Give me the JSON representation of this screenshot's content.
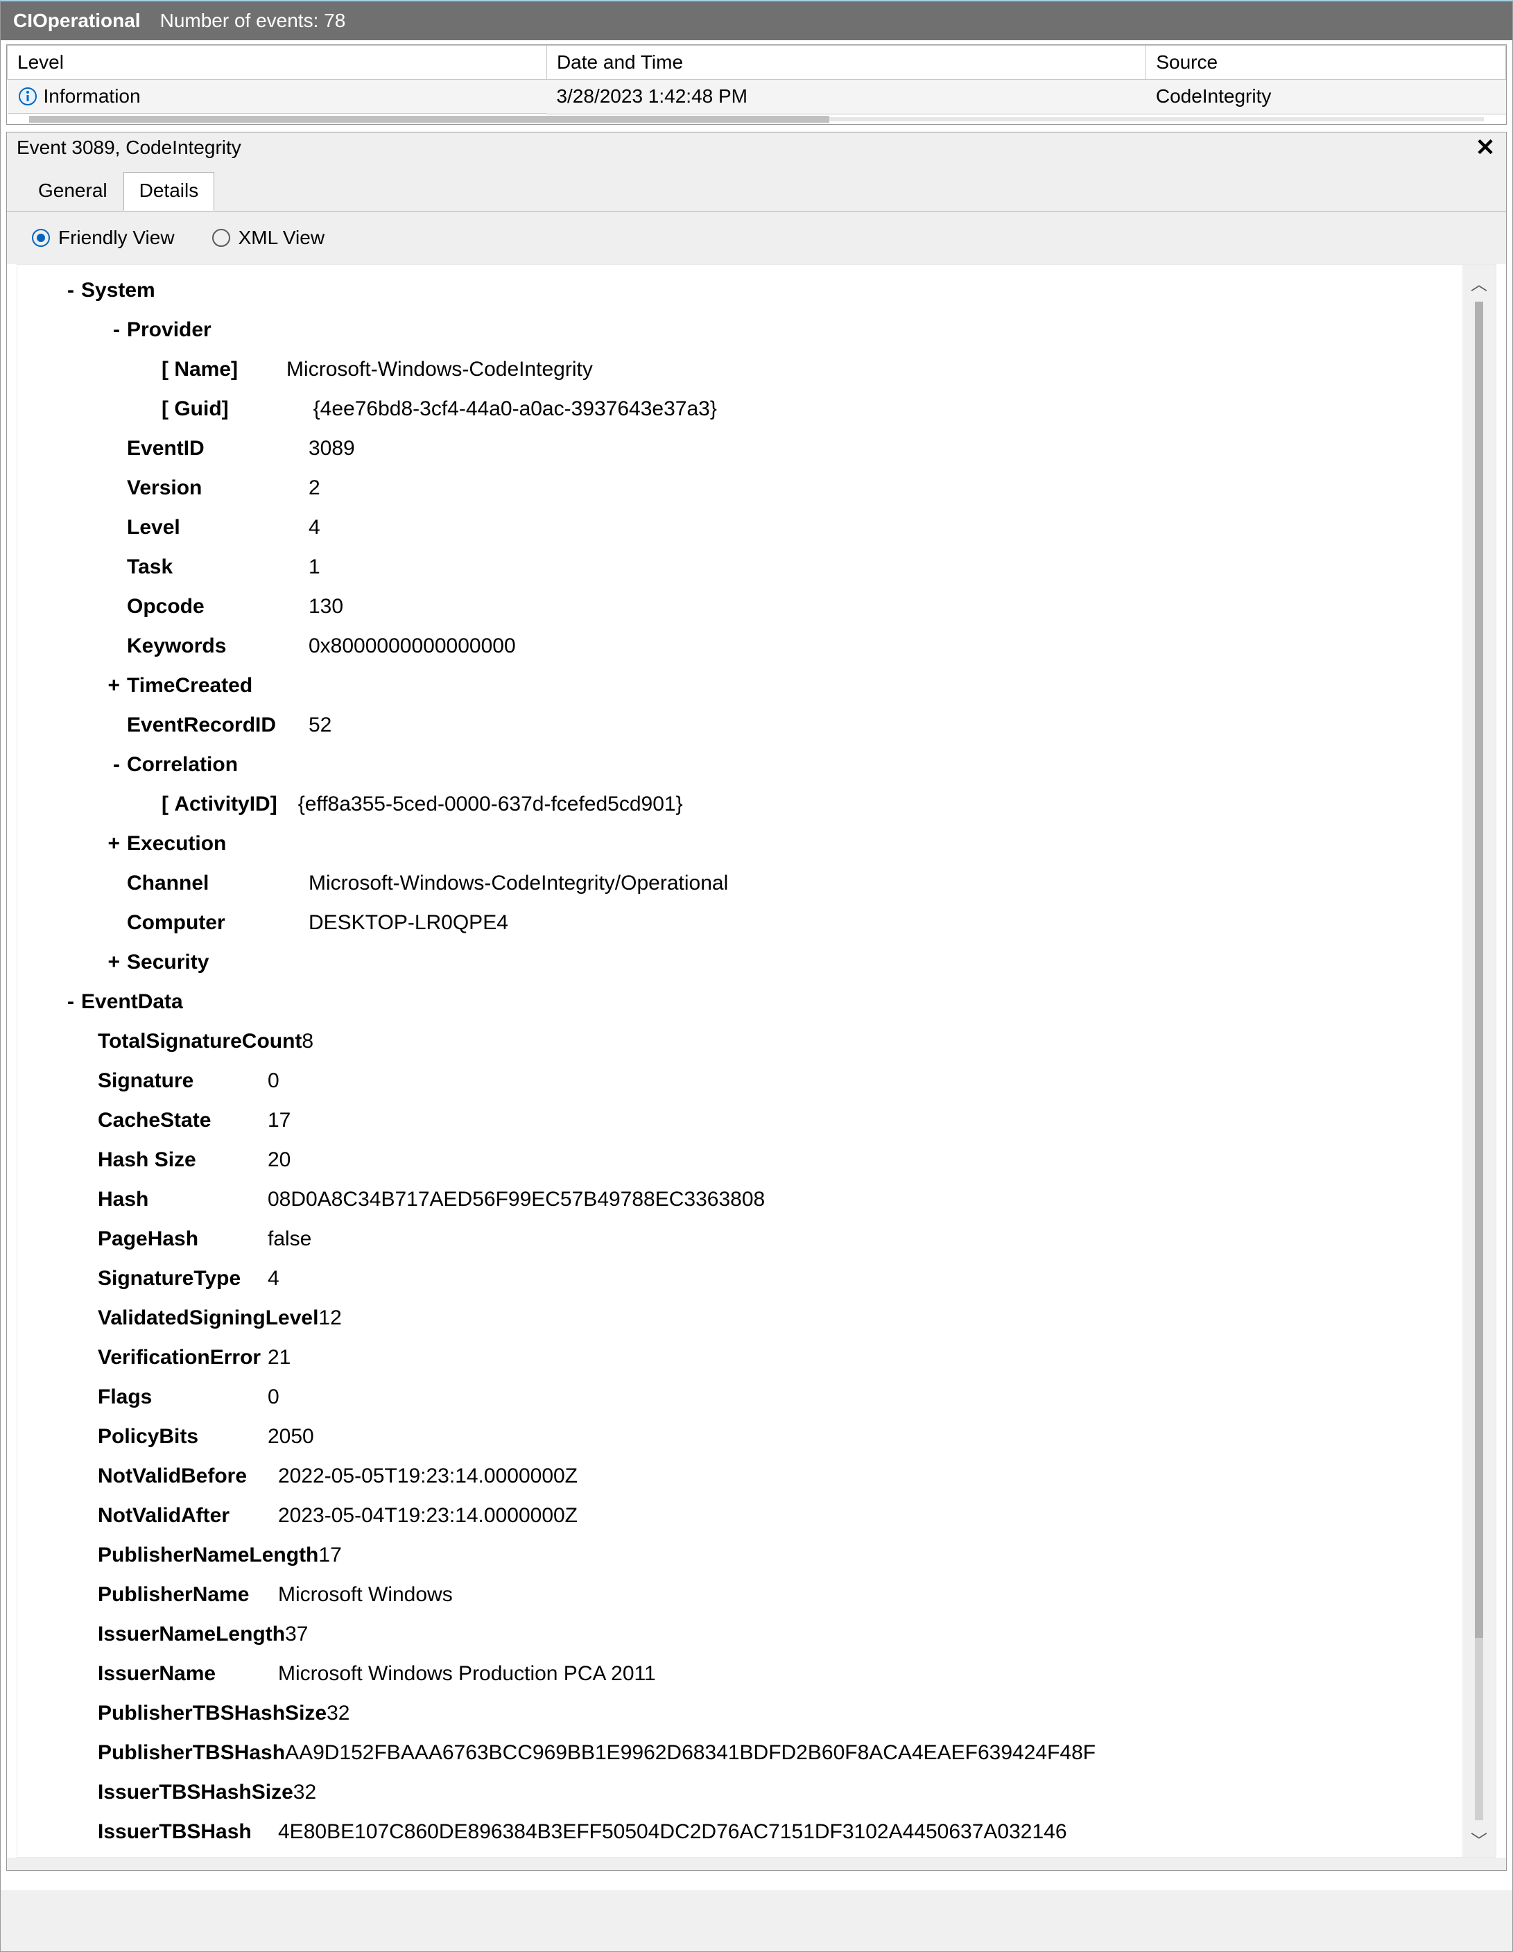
{
  "titleBar": {
    "name": "CIOperational",
    "events": "Number of events: 78"
  },
  "gridHeaders": {
    "level": "Level",
    "datetime": "Date and Time",
    "source": "Source"
  },
  "gridRow": {
    "level": "Information",
    "datetime": "3/28/2023 1:42:48 PM",
    "source": "CodeIntegrity"
  },
  "panelTitle": "Event 3089, CodeIntegrity",
  "tabs": {
    "general": "General",
    "details": "Details"
  },
  "radios": {
    "friendly": "Friendly View",
    "xml": "XML View"
  },
  "tree": {
    "system": "System",
    "provider": "Provider",
    "providerNameLabel": "[ Name]",
    "providerNameValue": "Microsoft-Windows-CodeIntegrity",
    "providerGuidLabel": "[ Guid]",
    "providerGuidValue": "{4ee76bd8-3cf4-44a0-a0ac-3937643e37a3}",
    "eventIdLabel": "EventID",
    "eventIdValue": "3089",
    "versionLabel": "Version",
    "versionValue": "2",
    "levelLabel": "Level",
    "levelValue": "4",
    "taskLabel": "Task",
    "taskValue": "1",
    "opcodeLabel": "Opcode",
    "opcodeValue": "130",
    "keywordsLabel": "Keywords",
    "keywordsValue": "0x8000000000000000",
    "timeCreatedLabel": "TimeCreated",
    "eventRecordIdLabel": "EventRecordID",
    "eventRecordIdValue": "52",
    "correlationLabel": "Correlation",
    "activityIdLabel": "[ ActivityID]",
    "activityIdValue": "{eff8a355-5ced-0000-637d-fcefed5cd901}",
    "executionLabel": "Execution",
    "channelLabel": "Channel",
    "channelValue": "Microsoft-Windows-CodeIntegrity/Operational",
    "computerLabel": "Computer",
    "computerValue": "DESKTOP-LR0QPE4",
    "securityLabel": "Security",
    "eventData": "EventData"
  },
  "eventData": {
    "totalSignatureCountLabel": "TotalSignatureCount",
    "totalSignatureCountValue": "8",
    "signatureLabel": "Signature",
    "signatureValue": "0",
    "cacheStateLabel": "CacheState",
    "cacheStateValue": "17",
    "hashSizeLabel": "Hash Size",
    "hashSizeValue": "20",
    "hashLabel": "Hash",
    "hashValue": "08D0A8C34B717AED56F99EC57B49788EC3363808",
    "pageHashLabel": "PageHash",
    "pageHashValue": "false",
    "signatureTypeLabel": "SignatureType",
    "signatureTypeValue": "4",
    "validatedSigningLevelLabel": "ValidatedSigningLevel",
    "validatedSigningLevelValue": "12",
    "verificationErrorLabel": "VerificationError",
    "verificationErrorValue": "21",
    "flagsLabel": "Flags",
    "flagsValue": "0",
    "policyBitsLabel": "PolicyBits",
    "policyBitsValue": "2050",
    "notValidBeforeLabel": "NotValidBefore",
    "notValidBeforeValue": "2022-05-05T19:23:14.0000000Z",
    "notValidAfterLabel": "NotValidAfter",
    "notValidAfterValue": "2023-05-04T19:23:14.0000000Z",
    "publisherNameLengthLabel": "PublisherNameLength",
    "publisherNameLengthValue": "17",
    "publisherNameLabel": "PublisherName",
    "publisherNameValue": "Microsoft Windows",
    "issuerNameLengthLabel": "IssuerNameLength",
    "issuerNameLengthValue": "37",
    "issuerNameLabel": "IssuerName",
    "issuerNameValue": "Microsoft Windows Production PCA 2011",
    "publisherTBSHashSizeLabel": "PublisherTBSHashSize",
    "publisherTBSHashSizeValue": "32",
    "publisherTBSHashLabel": "PublisherTBSHash",
    "publisherTBSHashValue": "AA9D152FBAAA6763BCC969BB1E9962D68341BDFD2B60F8ACA4EAEF639424F48F",
    "issuerTBSHashSizeLabel": "IssuerTBSHashSize",
    "issuerTBSHashSizeValue": "32",
    "issuerTBSHashLabel": "IssuerTBSHash",
    "issuerTBSHashValue": "4E80BE107C860DE896384B3EFF50504DC2D76AC7151DF3102A4450637A032146"
  }
}
